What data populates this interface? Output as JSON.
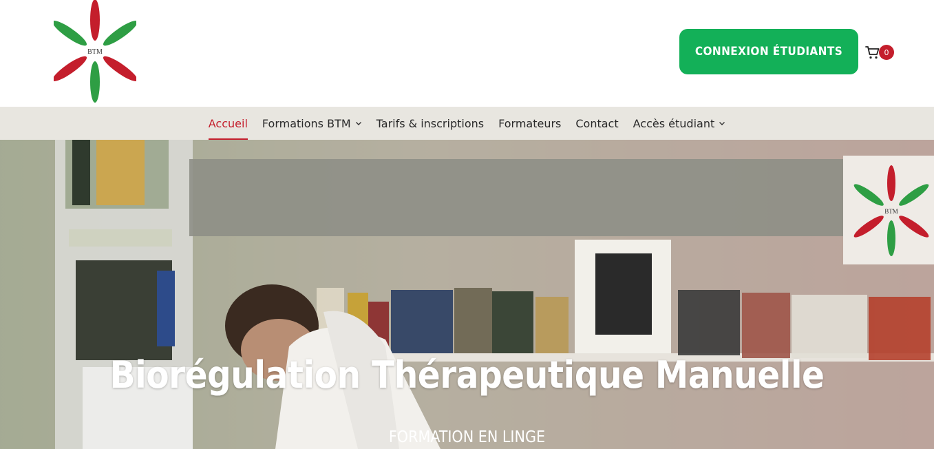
{
  "brand": {
    "logo_text": "BTM",
    "colors": {
      "green": "#13b058",
      "red": "#c41e2c",
      "logo_green": "#2e9e44",
      "logo_red": "#c41e2c"
    }
  },
  "header": {
    "cta_label": "Connexion étudiants",
    "cart": {
      "icon": "shopping-cart-icon",
      "count": "0"
    }
  },
  "nav": {
    "items": [
      {
        "label": "Accueil",
        "active": true,
        "has_dropdown": false
      },
      {
        "label": "Formations BTM",
        "active": false,
        "has_dropdown": true
      },
      {
        "label": "Tarifs & inscriptions",
        "active": false,
        "has_dropdown": false
      },
      {
        "label": "Formateurs",
        "active": false,
        "has_dropdown": false
      },
      {
        "label": "Contact",
        "active": false,
        "has_dropdown": false
      },
      {
        "label": "Accès étudiant",
        "active": false,
        "has_dropdown": true
      }
    ]
  },
  "hero": {
    "title": "Biorégulation Thérapeutique Manuelle",
    "subtitle": "FORMATION EN LINGE",
    "wall_logo_text": "BTM"
  }
}
